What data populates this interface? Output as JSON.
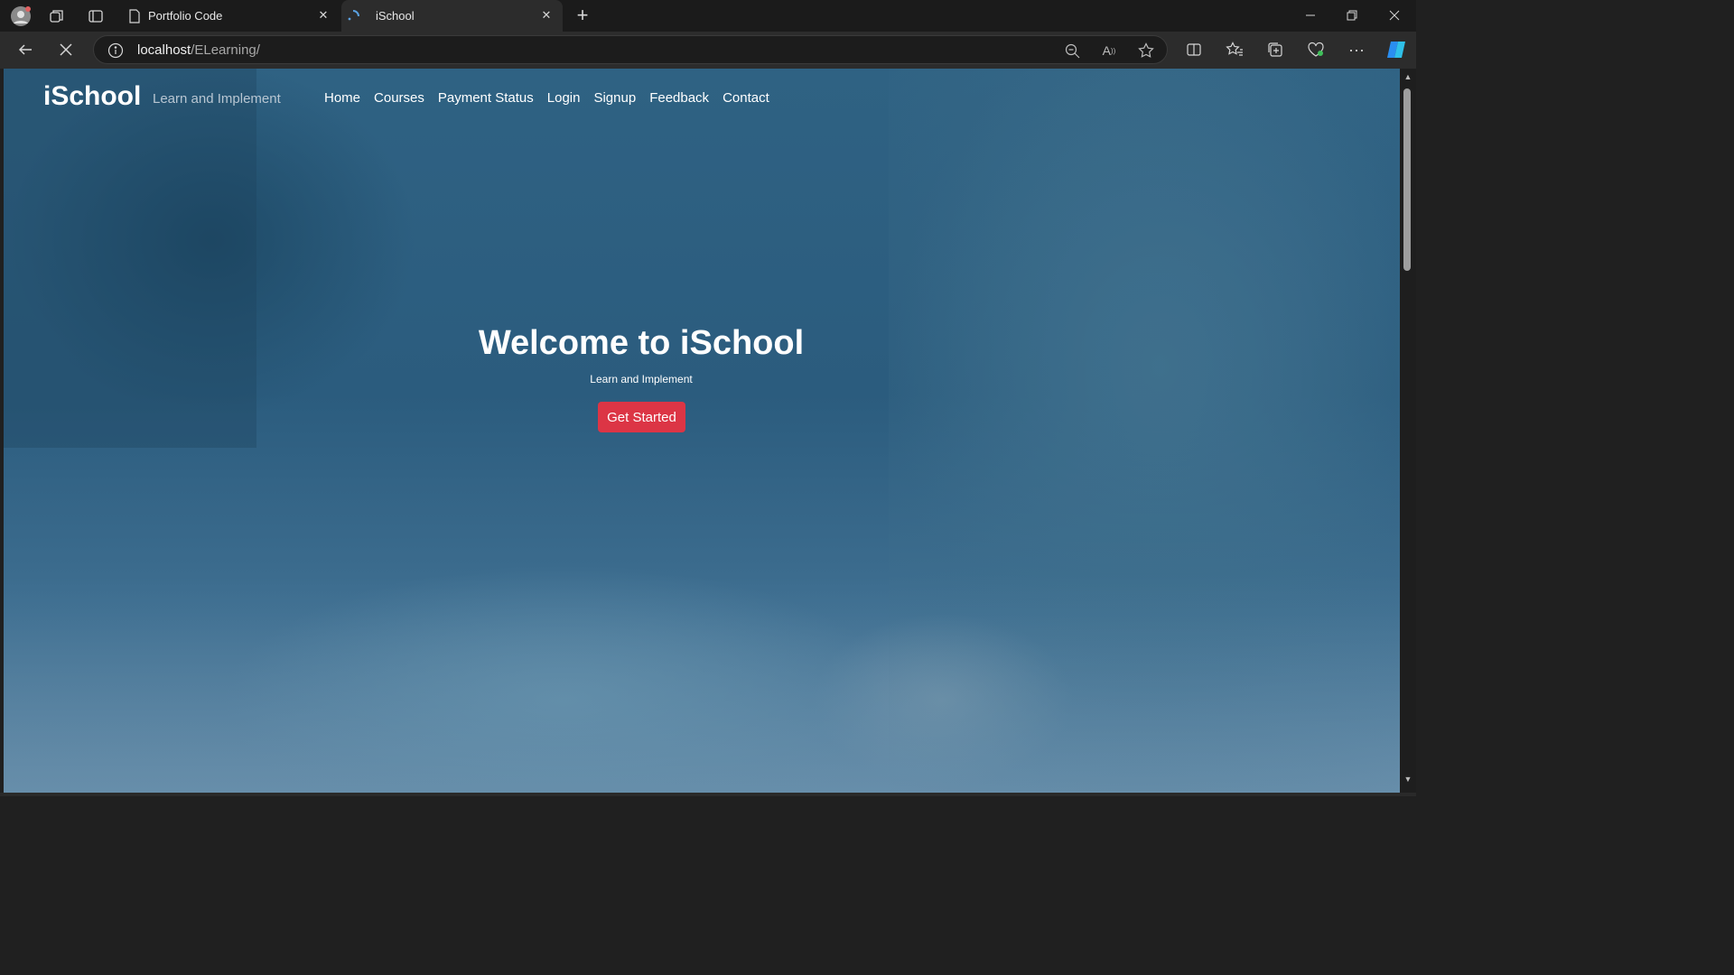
{
  "browser": {
    "tabs": [
      {
        "title": "Portfolio Code",
        "active": false
      },
      {
        "title": "iSchool",
        "active": true
      }
    ],
    "address": {
      "host": "localhost",
      "path": "/ELearning/"
    }
  },
  "site": {
    "brand": "iSchool",
    "tagline": "Learn and Implement",
    "nav": [
      "Home",
      "Courses",
      "Payment Status",
      "Login",
      "Signup",
      "Feedback",
      "Contact"
    ]
  },
  "hero": {
    "title": "Welcome to iSchool",
    "subtitle": "Learn and Implement",
    "cta": "Get Started"
  },
  "colors": {
    "cta": "#dc3545",
    "overlay": "#2d5d80",
    "chrome": "#202020"
  }
}
